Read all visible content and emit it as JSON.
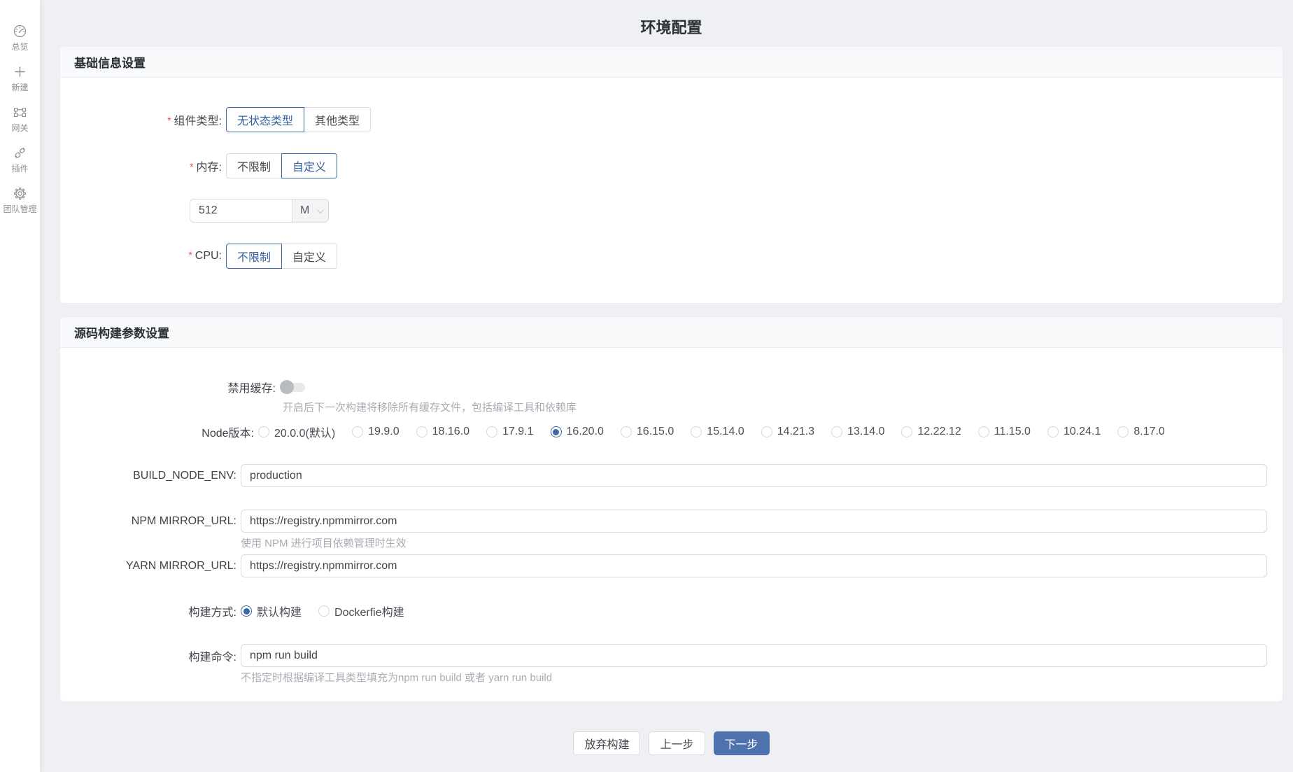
{
  "page": {
    "title": "环境配置"
  },
  "colors": {
    "accent_blue": "#3a68a8",
    "primary_button": "#4d72ae",
    "page_background": "#eef0f3",
    "card_header_background": "#f7f9fb",
    "required_mark": "#f5413d",
    "helper_text": "#a9adb3"
  },
  "sidebar": {
    "items": [
      {
        "icon": "dashboard-icon",
        "label": "总览"
      },
      {
        "icon": "plus-icon",
        "label": "新建"
      },
      {
        "icon": "gateway-icon",
        "label": "网关"
      },
      {
        "icon": "plug-icon",
        "label": "插件"
      },
      {
        "icon": "gear-icon",
        "label": "团队管理"
      }
    ]
  },
  "basic_card": {
    "title": "基础信息设置",
    "component_type": {
      "label": "组件类型:",
      "options": [
        "无状态类型",
        "其他类型"
      ],
      "selected": "无状态类型"
    },
    "memory": {
      "label": "内存:",
      "options": [
        "不限制",
        "自定义"
      ],
      "selected": "自定义",
      "value": "512",
      "unit": "M"
    },
    "cpu": {
      "label": "CPU:",
      "options": [
        "不限制",
        "自定义"
      ],
      "selected": "不限制"
    }
  },
  "build_card": {
    "title": "源码构建参数设置",
    "disable_cache": {
      "label": "禁用缓存:",
      "enabled": false,
      "help": "开启后下一次构建将移除所有缓存文件，包括编译工具和依赖库"
    },
    "node_version": {
      "label": "Node版本:",
      "options": [
        "20.0.0(默认)",
        "19.9.0",
        "18.16.0",
        "17.9.1",
        "16.20.0",
        "16.15.0",
        "15.14.0",
        "14.21.3",
        "13.14.0",
        "12.22.12",
        "11.15.0",
        "10.24.1",
        "8.17.0"
      ],
      "selected": "16.20.0"
    },
    "build_node_env": {
      "label": "BUILD_NODE_ENV:",
      "value": "production"
    },
    "npm_mirror": {
      "label": "NPM MIRROR_URL:",
      "value": "https://registry.npmmirror.com",
      "help": "使用 NPM 进行项目依赖管理时生效"
    },
    "yarn_mirror": {
      "label": "YARN MIRROR_URL:",
      "value": "https://registry.npmmirror.com"
    },
    "build_method": {
      "label": "构建方式:",
      "options": [
        "默认构建",
        "Dockerfie构建"
      ],
      "selected": "默认构建"
    },
    "build_command": {
      "label": "构建命令:",
      "value": "npm run build",
      "help": "不指定时根据编译工具类型填充为npm run build 或者 yarn run build"
    }
  },
  "footer": {
    "abandon_label": "放弃构建",
    "prev_label": "上一步",
    "next_label": "下一步"
  }
}
